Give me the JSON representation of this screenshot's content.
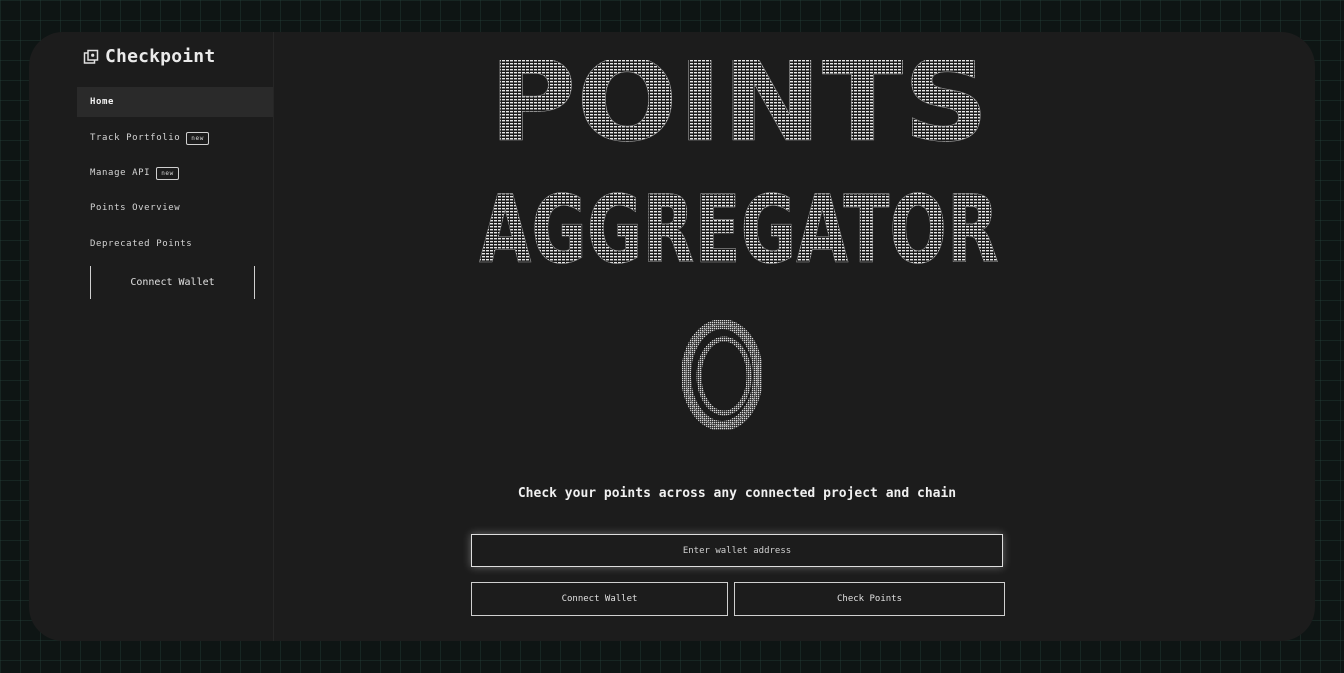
{
  "brand": {
    "name": "Checkpoint"
  },
  "sidebar": {
    "items": [
      {
        "label": "Home",
        "active": true,
        "badge": ""
      },
      {
        "label": "Track Portfolio",
        "active": false,
        "badge": "new"
      },
      {
        "label": "Manage API",
        "active": false,
        "badge": "new"
      },
      {
        "label": "Points Overview",
        "active": false,
        "badge": ""
      },
      {
        "label": "Deprecated Points",
        "active": false,
        "badge": ""
      }
    ],
    "connect_label": "Connect Wallet"
  },
  "hero": {
    "line1": "POINTS",
    "line2": "AGGREGATOR",
    "icon": "ascii-ring-icon"
  },
  "tagline": "Check your points across any connected project and chain",
  "form": {
    "address_placeholder": "Enter wallet address",
    "address_value": "",
    "connect_label": "Connect Wallet",
    "check_label": "Check Points"
  },
  "colors": {
    "background": "#0e1514",
    "panel": "#1c1c1c",
    "active_item": "#2a2a2a",
    "text": "#e6e6e6"
  }
}
